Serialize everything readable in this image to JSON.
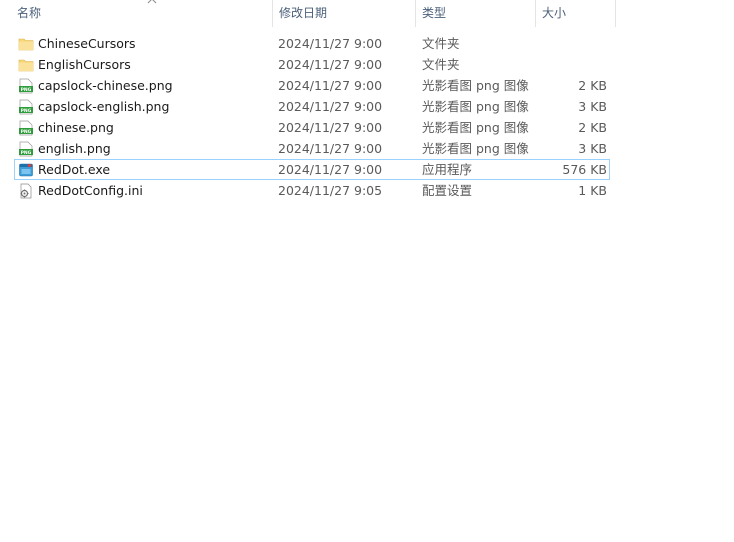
{
  "columns": {
    "name": "名称",
    "date": "修改日期",
    "type": "类型",
    "size": "大小"
  },
  "files": [
    {
      "name": "ChineseCursors",
      "date": "2024/11/27 9:00",
      "type": "文件夹",
      "size": "",
      "icon": "folder-icon"
    },
    {
      "name": "EnglishCursors",
      "date": "2024/11/27 9:00",
      "type": "文件夹",
      "size": "",
      "icon": "folder-icon"
    },
    {
      "name": "capslock-chinese.png",
      "date": "2024/11/27 9:00",
      "type": "光影看图 png 图像",
      "size": "2 KB",
      "icon": "png-file-icon"
    },
    {
      "name": "capslock-english.png",
      "date": "2024/11/27 9:00",
      "type": "光影看图 png 图像",
      "size": "3 KB",
      "icon": "png-file-icon"
    },
    {
      "name": "chinese.png",
      "date": "2024/11/27 9:00",
      "type": "光影看图 png 图像",
      "size": "2 KB",
      "icon": "png-file-icon"
    },
    {
      "name": "english.png",
      "date": "2024/11/27 9:00",
      "type": "光影看图 png 图像",
      "size": "3 KB",
      "icon": "png-file-icon"
    },
    {
      "name": "RedDot.exe",
      "date": "2024/11/27 9:00",
      "type": "应用程序",
      "size": "576 KB",
      "icon": "exe-file-icon",
      "selected": true
    },
    {
      "name": "RedDotConfig.ini",
      "date": "2024/11/27 9:05",
      "type": "配置设置",
      "size": "1 KB",
      "icon": "ini-file-icon"
    }
  ],
  "colors": {
    "selection_border": "#99d1ff",
    "header_text": "#4c607a",
    "folder": "#f8d775"
  }
}
